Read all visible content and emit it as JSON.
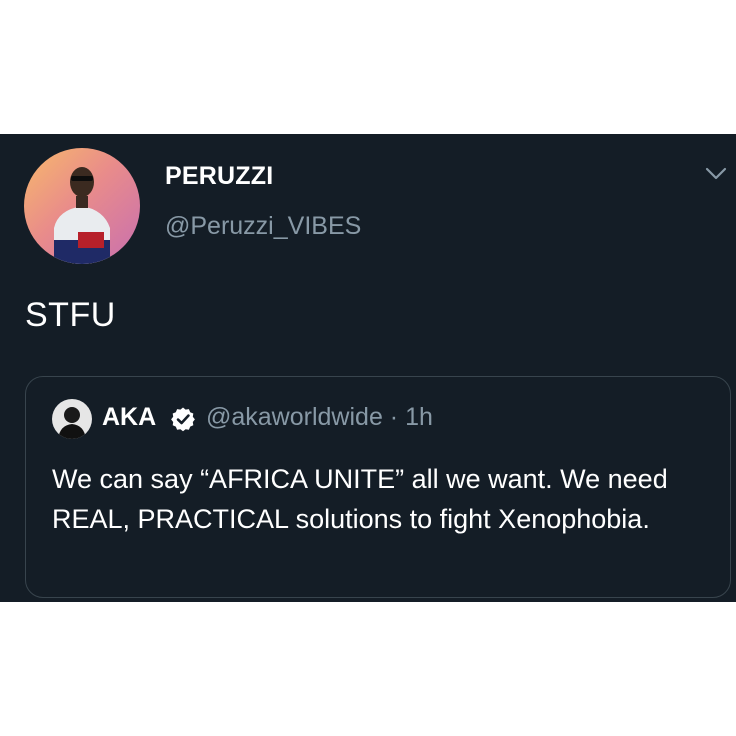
{
  "tweet": {
    "display_name": "PERUZZI",
    "handle": "@Peruzzi_VIBES",
    "text": "STFU",
    "menu_icon": "chevron-down-icon"
  },
  "quoted_tweet": {
    "display_name": "AKA",
    "verified_icon": "verified-badge-icon",
    "handle": "@akaworldwide",
    "separator": "·",
    "time": "1h",
    "text": "We can say “AFRICA UNITE” all we want. We need REAL, PRACTICAL solutions to fight Xenophobia."
  },
  "colors": {
    "background": "#141d26",
    "page": "#ffffff",
    "secondary_text": "#8899a6",
    "border": "#38444d"
  }
}
